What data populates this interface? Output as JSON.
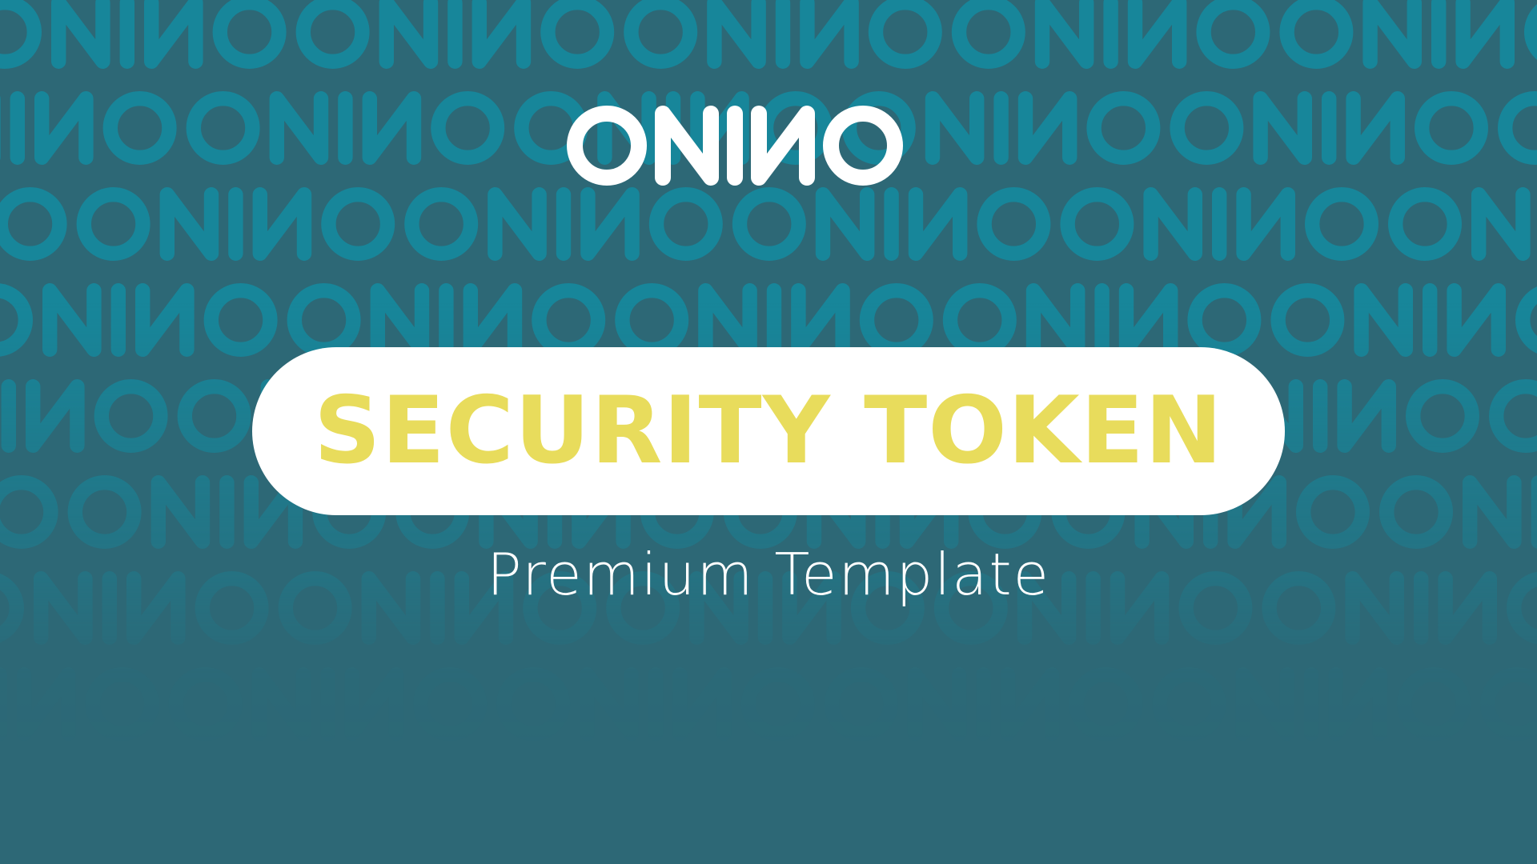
{
  "brand": {
    "name": "ONINO"
  },
  "title": "SECURITY TOKEN",
  "subtitle": "Premium Template",
  "colors": {
    "background": "#2d6876",
    "pattern": "#17869a",
    "pill": "#ffffff",
    "title": "#e8dc5c",
    "subtitle": "#ffffff",
    "logo": "#ffffff"
  },
  "icons": {
    "background_pattern": "onino-wordmark-pattern",
    "logo": "onino-logo"
  }
}
